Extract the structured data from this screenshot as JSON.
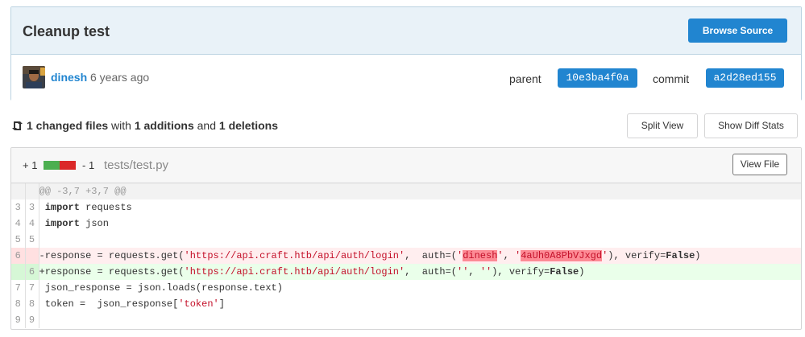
{
  "commit": {
    "title": "Cleanup test",
    "browse_label": "Browse Source",
    "author": "dinesh",
    "time": "6 years ago",
    "parent_label": "parent",
    "parent_sha": "10e3ba4f0a",
    "commit_label": "commit",
    "commit_sha": "a2d28ed155"
  },
  "stats": {
    "changed": "1 changed files",
    "with": "with",
    "additions": "1 additions",
    "and": "and",
    "deletions": "1 deletions",
    "split_label": "Split View",
    "diffstats_label": "Show Diff Stats"
  },
  "file": {
    "add_count": "+ 1",
    "del_count": "- 1",
    "name": "tests/test.py",
    "view_label": "View File",
    "add_color": "#4caf50",
    "del_color": "#db2828"
  },
  "diff": {
    "hunk": "@@ -3,7 +3,7 @@",
    "lines": [
      {
        "old": "3",
        "new": "3",
        "type": "ctx",
        "text": " import requests"
      },
      {
        "old": "4",
        "new": "4",
        "type": "ctx",
        "text": " import json"
      },
      {
        "old": "5",
        "new": "5",
        "type": "ctx",
        "text": ""
      },
      {
        "old": "6",
        "new": "",
        "type": "del",
        "text": "-response = requests.get('https://api.craft.htb/api/auth/login',  auth=('dinesh', '4aUh0A8PbVJxgd'), verify=False)"
      },
      {
        "old": "",
        "new": "6",
        "type": "add",
        "text": "+response = requests.get('https://api.craft.htb/api/auth/login',  auth=('', ''), verify=False)"
      },
      {
        "old": "7",
        "new": "7",
        "type": "ctx",
        "text": " json_response = json.loads(response.text)"
      },
      {
        "old": "8",
        "new": "8",
        "type": "ctx",
        "text": " token =  json_response['token']"
      },
      {
        "old": "9",
        "new": "9",
        "type": "ctx",
        "text": ""
      }
    ]
  }
}
